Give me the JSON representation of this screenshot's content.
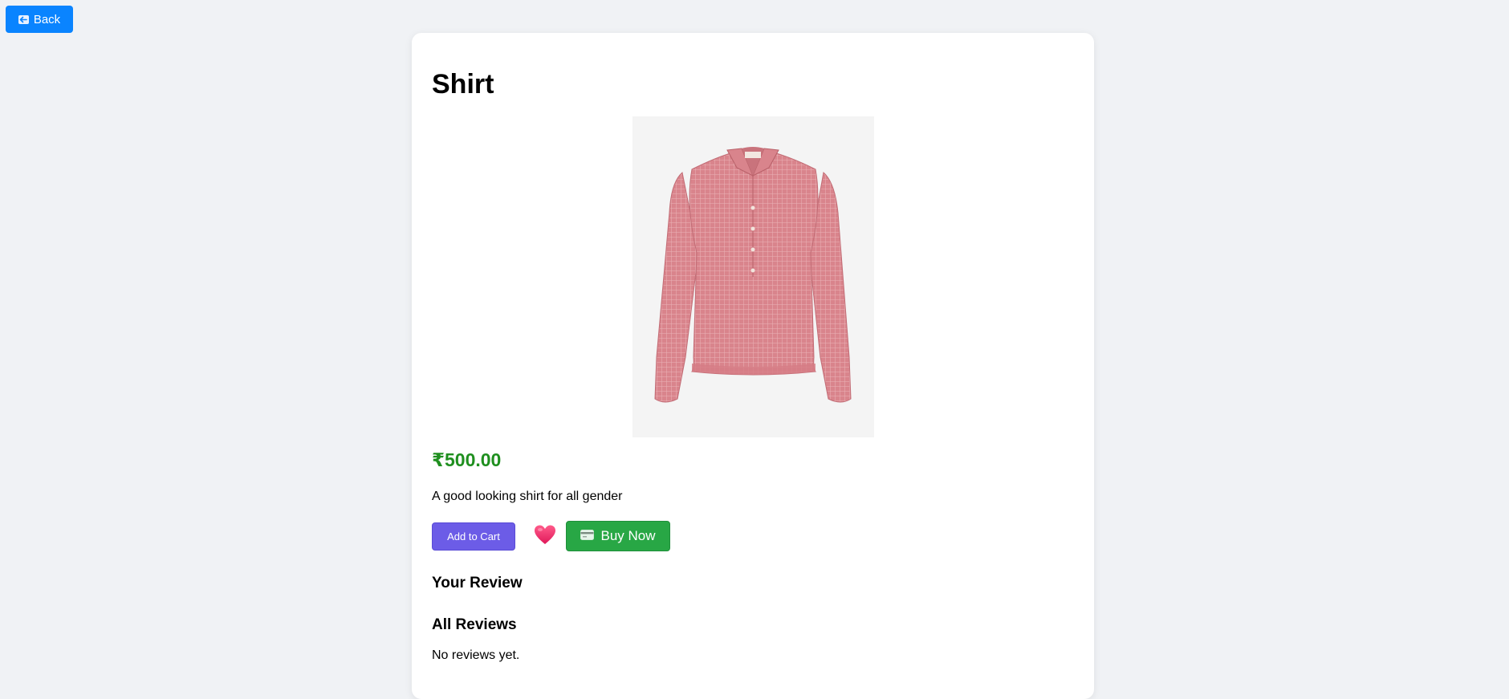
{
  "header": {
    "back_label": "Back",
    "back_icon": "arrow-left-icon"
  },
  "product": {
    "title": "Shirt",
    "image_alt": "Pink checked long-sleeve shirt",
    "price": "₹500.00",
    "description": "A good looking shirt for all gender"
  },
  "actions": {
    "add_to_cart_label": "Add to Cart",
    "wishlist_icon": "heart-icon",
    "buy_now_label": "Buy Now",
    "buy_now_icon": "credit-card-icon"
  },
  "reviews": {
    "your_review_heading": "Your Review",
    "all_reviews_heading": "All Reviews",
    "empty_text": "No reviews yet."
  },
  "colors": {
    "back_button": "#0a84ff",
    "price": "#1f8f1f",
    "add_to_cart": "#6c5ce7",
    "buy_now": "#28a745",
    "heart": "#f0266d"
  }
}
